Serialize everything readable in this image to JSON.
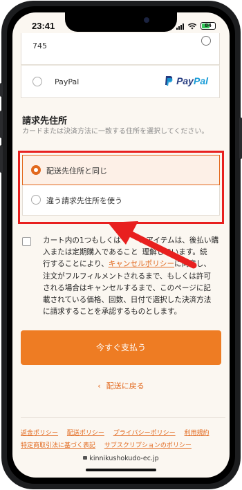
{
  "status_bar": {
    "time": "23:41",
    "battery": "84"
  },
  "payment": {
    "prev_field_value": "745",
    "paypal_label": "PayPal",
    "paypal_logo_text_1": "Pay",
    "paypal_logo_text_2": "Pal"
  },
  "billing": {
    "title": "請求先住所",
    "description": "カードまたは決済方法に一致する住所を選択してください。",
    "options": [
      {
        "label": "配送先住所と同じ",
        "selected": true
      },
      {
        "label": "違う請求先住所を使う",
        "selected": false
      }
    ]
  },
  "terms": {
    "line1": "カート内の1つもしくは",
    "line1b": "のアイテムは、後払い購",
    "line2": "入または定期購入であること",
    "line2b": "理解しています。続",
    "line3a": "行することにより、",
    "line3_link": "キャンセルポリシー",
    "line3b": "に同意し、",
    "line4": "注文がフルフィルメントされるまで、もしくは許可",
    "line5": "される場合はキャンセルするまで、このページに記",
    "line6": "載されている価格、回数、日付で選択した決済方法",
    "line7": "に請求することを承認するものとします。"
  },
  "actions": {
    "pay_now": "今すぐ支払う",
    "back": "配送に戻る"
  },
  "footer": {
    "row1": [
      "返金ポリシー",
      "配送ポリシー",
      "プライバシーポリシー",
      "利用規約"
    ],
    "row2": [
      "特定商取引法に基づく表記",
      "サブスクリプションのポリシー"
    ]
  },
  "url": "kinnikushokudo-ec.jp",
  "colors": {
    "accent": "#ee7c23",
    "highlight": "#e8201f",
    "paypal_dark": "#253b80",
    "paypal_light": "#179bd7"
  }
}
